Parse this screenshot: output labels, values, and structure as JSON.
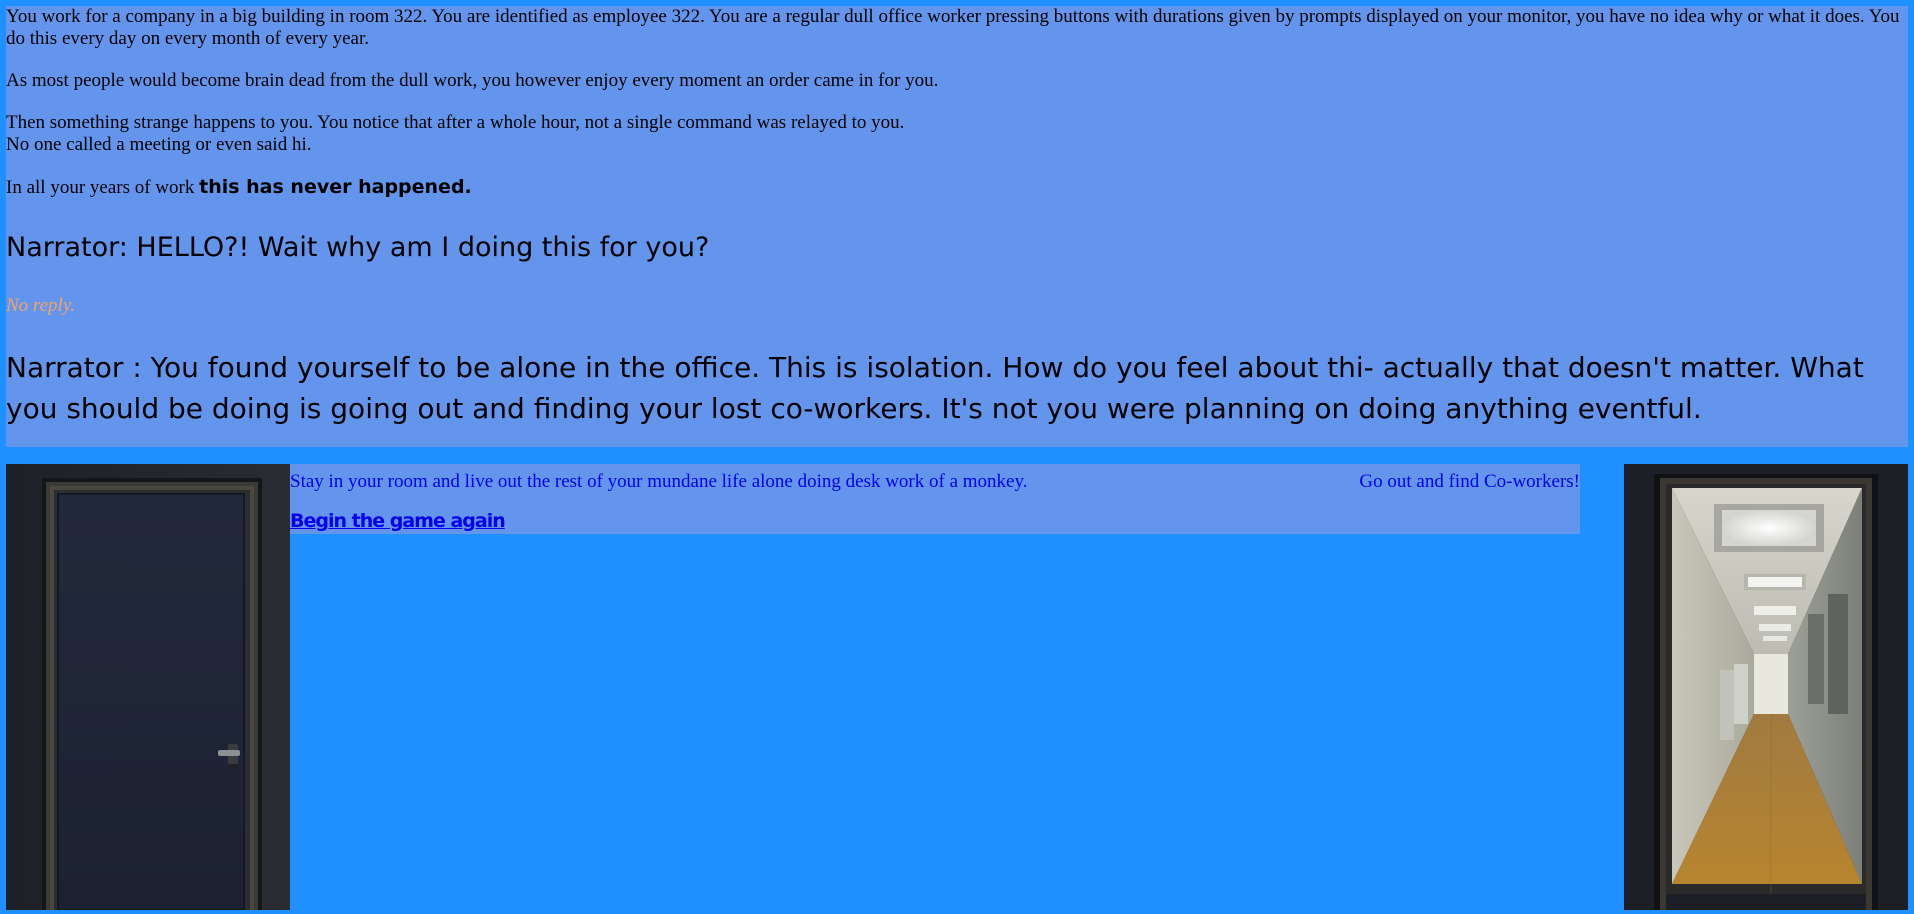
{
  "story": {
    "p1": "You work for a company in a big building in room 322. You are identified as employee 322. You are a regular dull office worker pressing buttons with durations given by prompts displayed on your monitor, you have no idea why or what it does. You do this every day on every month of every year.",
    "p2": "As most people would become brain dead from the dull work, you however enjoy every moment an order came in for you.",
    "p3_line1": "Then something strange happens to you. You notice that after a whole hour, not a single command was relayed to you.",
    "p3_line2": "No one called a meeting or even said hi.",
    "p4_lead": "In all your years of work ",
    "p4_emphasis": "this has never happened.",
    "narrator1": "Narrator: HELLO?! Wait why am I doing this for you?",
    "no_reply": "No reply.",
    "narrator2": "Narrator : You found yourself to be alone in the office. This is isolation. How do you feel about thi- actually that doesn't matter. What you should be doing is going out and finding your lost co-workers. It's not you were planning on doing anything eventful."
  },
  "choices": {
    "stay_label": "Stay in your room and live out the rest of your mundane life alone doing desk work of a monkey.",
    "go_label": "Go out and find Co-workers!",
    "restart_label": "Begin the game again"
  },
  "colors": {
    "page_bg": "#1E90FF",
    "panel_bg": "#6495ED",
    "link": "#0000EE",
    "no_reply": "#F4A460"
  },
  "images": {
    "left": "closed-office-door-image",
    "right": "open-door-hallway-image"
  }
}
